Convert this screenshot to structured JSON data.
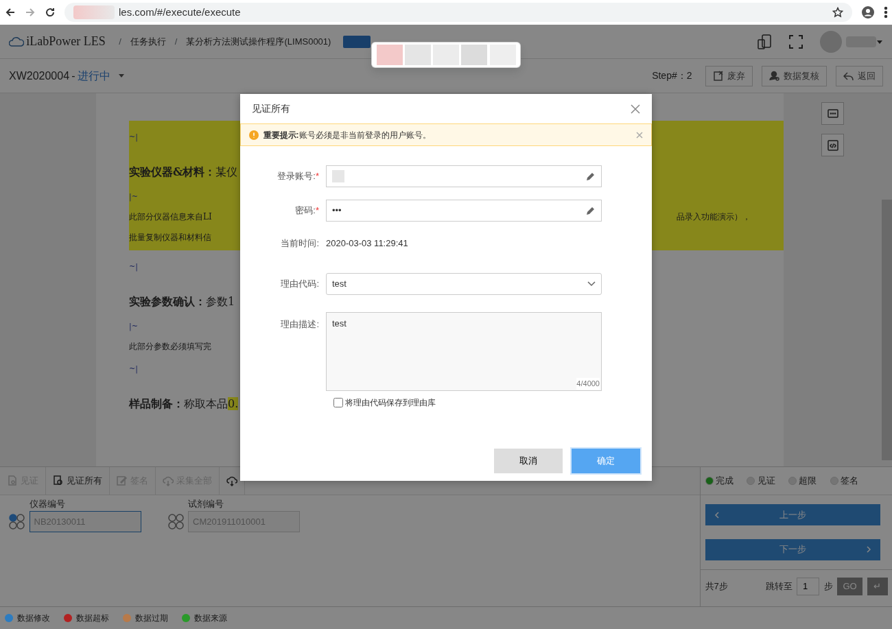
{
  "browser": {
    "url": "les.com/#/execute/execute"
  },
  "header": {
    "logo": "iLabPower LES",
    "separator": "/",
    "breadcrumb": [
      "任务执行",
      "某分析方法测试操作程序(LIMS0001)"
    ]
  },
  "subheader": {
    "record": "XW2020004",
    "separator": "-",
    "status": "进行中",
    "step": "Step#：2",
    "buttons": [
      {
        "kind": "discard",
        "label": "废弃"
      },
      {
        "kind": "review",
        "label": "数据复核"
      },
      {
        "kind": "back",
        "label": "返回"
      }
    ]
  },
  "document": {
    "lines": [
      {
        "kind": "marker",
        "text": "~|",
        "highlighted": true
      },
      {
        "kind": "heading",
        "text": "**实验仪器&材料：**某仪",
        "highlighted": true
      },
      {
        "kind": "marker",
        "text": "|~",
        "highlighted": true
      },
      {
        "kind": "note",
        "text": "此部分仪器信息来自LI",
        "tail": "品录入功能演示），",
        "highlighted": true
      },
      {
        "kind": "note",
        "text": "批量复制仪器和材料信",
        "highlighted": true
      },
      {
        "kind": "marker",
        "text": "~|",
        "highlighted": false
      },
      {
        "kind": "heading",
        "text": "**实验参数确认：**参数1",
        "highlighted": false
      },
      {
        "kind": "marker",
        "text": "|~",
        "highlighted": false
      },
      {
        "kind": "note",
        "text": "此部分参数必须填写完",
        "highlighted": false
      },
      {
        "kind": "marker",
        "text": "~|",
        "highlighted": false
      },
      {
        "kind": "heading",
        "text": "**样品制备：**称取本品",
        "mark": "0.",
        "highlighted": false
      }
    ]
  },
  "toolbar": [
    {
      "kind": "witness",
      "label": "见证",
      "enabled": false
    },
    {
      "kind": "witness-all",
      "label": "见证所有",
      "enabled": true
    },
    {
      "kind": "sign",
      "label": "签名",
      "enabled": false
    },
    {
      "kind": "collect",
      "label": "采集全部",
      "enabled": false
    },
    {
      "kind": "collect",
      "enabled": true
    }
  ],
  "fields": [
    {
      "label": "仪器编号",
      "value": "NB20130011",
      "focused": true
    },
    {
      "label": "试剂编号",
      "value": "CM201911010001",
      "focused": false
    }
  ],
  "status_filters": [
    {
      "label": "完成",
      "on": true
    },
    {
      "label": "见证",
      "on": false
    },
    {
      "label": "超限",
      "on": false
    },
    {
      "label": "签名",
      "on": false
    }
  ],
  "navigation": {
    "prev": "上一步",
    "next": "下一步",
    "total": "共7步",
    "jump_label": "跳转至",
    "jump_value": "1",
    "jump_unit": "步",
    "go": "GO",
    "enter": "↵"
  },
  "legend": [
    {
      "label": "数据修改",
      "color": "#2d7cc0"
    },
    {
      "label": "数据超标",
      "color": "#b22222"
    },
    {
      "label": "数据过期",
      "color": "#b87a4a"
    },
    {
      "label": "数据来源",
      "color": "#2a9a2a"
    }
  ],
  "dialog": {
    "title": "见证所有",
    "required_mark": "*",
    "alert": "**重要提示:**账号必须是非当前登录的用户账号。",
    "account": {
      "label": "登录账号:",
      "required": true
    },
    "password": {
      "label": "密码:",
      "required": true,
      "value": "•••"
    },
    "time": {
      "label": "当前时间:",
      "value": "2020-03-03 11:29:41"
    },
    "reason_code": {
      "label": "理由代码:",
      "value": "test"
    },
    "reason_desc": {
      "label": "理由描述:",
      "value": "test",
      "counter": "4/4000"
    },
    "save_option": {
      "label": "将理由代码保存到理由库",
      "checked": false
    },
    "cancel": "取消",
    "confirm": "确定"
  }
}
